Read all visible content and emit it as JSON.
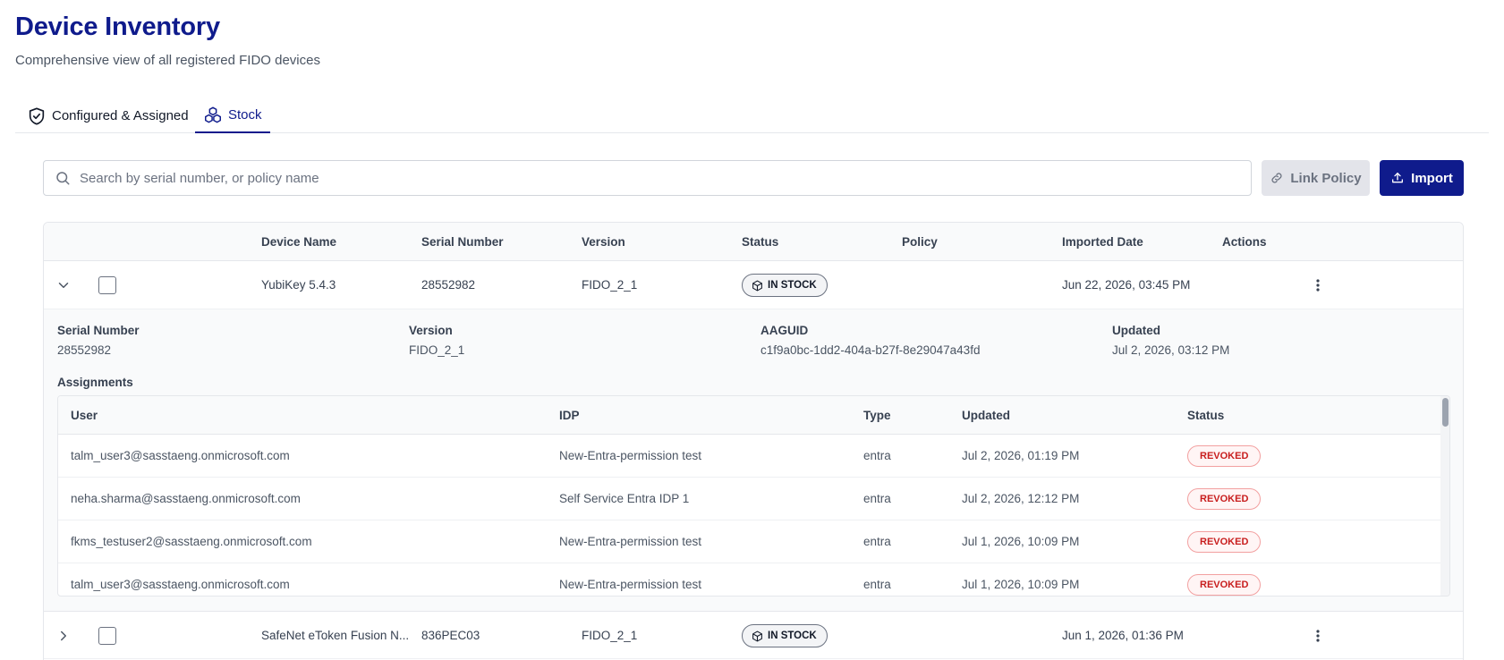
{
  "header": {
    "title": "Device Inventory",
    "subtitle": "Comprehensive view of all registered FIDO devices"
  },
  "tabs": [
    {
      "label": "Configured & Assigned",
      "icon": "shield-check-icon",
      "active": false
    },
    {
      "label": "Stock",
      "icon": "boxes-icon",
      "active": true
    }
  ],
  "search": {
    "placeholder": "Search by serial number, or policy name",
    "value": ""
  },
  "toolbar": {
    "link_policy_label": "Link Policy",
    "import_label": "Import"
  },
  "colors": {
    "brand": "#0f1b8c",
    "revoked": "#c81e1e",
    "disabled_button": "#e3e4ea"
  },
  "table": {
    "columns": [
      "Device Name",
      "Serial Number",
      "Version",
      "Status",
      "Policy",
      "Imported Date",
      "Actions"
    ],
    "rows": [
      {
        "expanded": true,
        "device_name": "YubiKey 5.4.3",
        "serial_number": "28552982",
        "version": "FIDO_2_1",
        "status": "IN STOCK",
        "policy": "",
        "imported_date": "Jun 22, 2026, 03:45 PM"
      },
      {
        "expanded": false,
        "device_name": "SafeNet eToken Fusion N...",
        "serial_number": "836PEC03",
        "version": "FIDO_2_1",
        "status": "IN STOCK",
        "policy": "",
        "imported_date": "Jun 1, 2026, 01:36 PM"
      }
    ]
  },
  "details": {
    "serial_label": "Serial Number",
    "serial_value": "28552982",
    "version_label": "Version",
    "version_value": "FIDO_2_1",
    "aaguid_label": "AAGUID",
    "aaguid_value": "c1f9a0bc-1dd2-404a-b27f-8e29047a43fd",
    "updated_label": "Updated",
    "updated_value": "Jul 2, 2026, 03:12 PM",
    "assignments_label": "Assignments",
    "assignment_columns": [
      "User",
      "IDP",
      "Type",
      "Updated",
      "Status"
    ],
    "assignments": [
      {
        "user": "talm_user3@sasstaeng.onmicrosoft.com",
        "idp": "New-Entra-permission test",
        "type": "entra",
        "updated": "Jul 2, 2026, 01:19 PM",
        "status": "REVOKED"
      },
      {
        "user": "neha.sharma@sasstaeng.onmicrosoft.com",
        "idp": "Self Service Entra IDP 1",
        "type": "entra",
        "updated": "Jul 2, 2026, 12:12 PM",
        "status": "REVOKED"
      },
      {
        "user": "fkms_testuser2@sasstaeng.onmicrosoft.com",
        "idp": "New-Entra-permission test",
        "type": "entra",
        "updated": "Jul 1, 2026, 10:09 PM",
        "status": "REVOKED"
      },
      {
        "user": "talm_user3@sasstaeng.onmicrosoft.com",
        "idp": "New-Entra-permission test",
        "type": "entra",
        "updated": "Jul 1, 2026, 10:09 PM",
        "status": "REVOKED"
      }
    ]
  }
}
